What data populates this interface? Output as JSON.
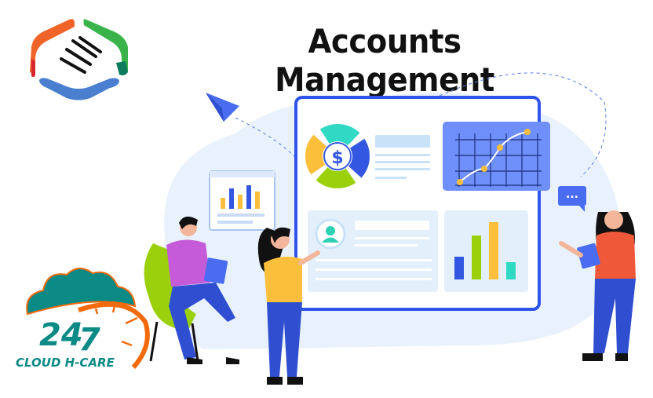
{
  "title": "Accounts Management",
  "dashboard": {
    "currency_symbol": "$",
    "chat_bubble": "...",
    "colors": {
      "panel_border": "#2f54eb",
      "chart_card": "#6f8ffb",
      "accent_yellow": "#fbbf3b",
      "accent_green": "#9bd10c",
      "accent_teal": "#2fd9c4",
      "accent_blue": "#3357e0"
    }
  },
  "badge": {
    "number_left": "24",
    "number_right": "7",
    "brand": "CLOUD H-CARE",
    "colors": {
      "teal": "#0b8a86",
      "orange": "#f26a0c"
    }
  }
}
